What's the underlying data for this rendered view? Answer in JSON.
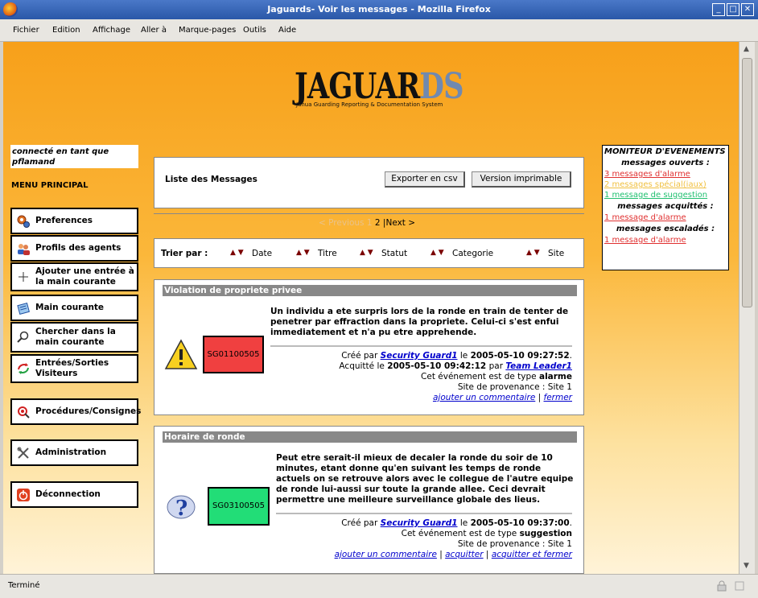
{
  "window": {
    "title": "Jaguards- Voir les messages - Mozilla Firefox"
  },
  "menu": {
    "items": [
      "Fichier",
      "Edition",
      "Affichage",
      "Aller à",
      "Marque-pages",
      "Outils",
      "Aide"
    ],
    "underline": [
      "F",
      "E",
      "A",
      "A",
      "M",
      "O",
      "A"
    ]
  },
  "status": {
    "text": "Terminé"
  },
  "logo": {
    "main": "JAGUAR",
    "accent": "DS",
    "sub": "Janua Guarding Reporting & Documentation System"
  },
  "user": {
    "connected": "connecté en tant que pflamand"
  },
  "nav": {
    "title": "MENU PRINCIPAL",
    "items": [
      {
        "label": "Preferences",
        "icon": "gears-icon"
      },
      {
        "label": "Profils des agents",
        "icon": "users-icon"
      },
      {
        "label": "Ajouter une entrée à la main courante",
        "icon": "plus-icon"
      },
      {
        "label": "Main courante",
        "icon": "notepad-icon"
      },
      {
        "label": "Chercher dans la main courante",
        "icon": "magnifier-icon"
      },
      {
        "label": "Entrées/Sorties Visiteurs",
        "icon": "arrows-icon"
      },
      {
        "label": "Procédures/Consignes",
        "icon": "procedure-icon"
      },
      {
        "label": "Administration",
        "icon": "tools-icon"
      },
      {
        "label": "Déconnection",
        "icon": "power-icon"
      }
    ]
  },
  "list": {
    "title": "Liste des Messages",
    "export": "Exporter en csv",
    "print": "Version imprimable"
  },
  "pager": {
    "prev": "< Previous",
    "page1": "1",
    "page2": "2",
    "next": "|Next >"
  },
  "sort": {
    "label": "Trier par :",
    "fields": [
      "Date",
      "Titre",
      "Statut",
      "Categorie",
      "Site"
    ]
  },
  "messages": [
    {
      "title": "Violation de propriete privee",
      "code": "SG01100505",
      "code_color": "#f04040",
      "icon": "warning-icon",
      "body": "Un individu a ete surpris lors de la ronde en train de tenter de penetrer par effraction dans la propriete. Celui-ci s'est enfui immediatement et n'a pu etre apprehende.",
      "created_pre": "Créé par",
      "created_by": "Security Guard1",
      "created_mid": "le",
      "created_date": "2005-05-10 09:27:52",
      "ack_pre": "Acquitté le",
      "ack_date": "2005-05-10 09:42:12",
      "ack_mid": "par",
      "ack_by": "Team Leader1",
      "type_pre": "Cet événement est de type",
      "type": "alarme",
      "site": "Site de provenance : Site 1",
      "link1": "ajouter un commentaire",
      "link2": "fermer"
    },
    {
      "title": "Horaire de ronde",
      "code": "SG03100505",
      "code_color": "#22dd77",
      "icon": "question-icon",
      "body": "Peut etre serait-il mieux de decaler la ronde du soir de 10 minutes, etant donne qu'en suivant les temps de ronde actuels on se retrouve alors avec le collegue de l'autre equipe de ronde lui-aussi sur toute la grande allee. Ceci devrait permettre une meilleure surveillance globale des lieus.",
      "created_pre": "Créé par",
      "created_by": "Security Guard1",
      "created_mid": "le",
      "created_date": "2005-05-10 09:37:00",
      "type_pre": "Cet événement est de type",
      "type": "suggestion",
      "site": "Site de provenance : Site 1",
      "link1": "ajouter un commentaire",
      "link2": "acquitter",
      "link3": "acquitter et fermer"
    }
  ],
  "monitor": {
    "title": "MONITEUR D'EVENEMENTS",
    "open": "messages ouverts :",
    "open_alarm": "3 messages d'alarme",
    "open_special": "2 messages spécial(iaux)",
    "open_suggestion": "1 message de suggestion",
    "acked": "messages acquittés :",
    "acked_alarm": "1 message d'alarme",
    "escalated": "messages escaladés :",
    "escalated_alarm": "1 message d'alarme",
    "colors": {
      "alarm": "#e03030",
      "special": "#f0c040",
      "suggestion": "#20c070"
    }
  }
}
